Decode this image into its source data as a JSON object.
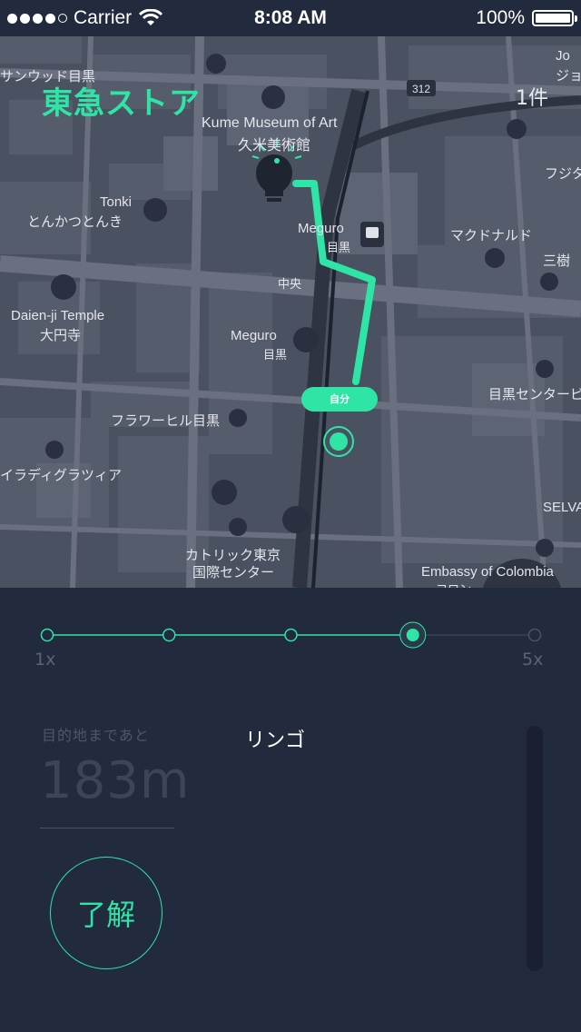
{
  "status_bar": {
    "carrier": "Carrier",
    "time": "8:08 AM",
    "battery": "100%"
  },
  "map": {
    "store_title": "東急ストア",
    "count": "1件",
    "self_label": "自分",
    "labels": {
      "sanwood": "サンウッド目黒",
      "kume_en": "Kume Museum of Art",
      "kume_jp": "久米美術館",
      "tonki_en": "Tonki",
      "tonki_jp": "とんかつとんき",
      "meguro_station": "Meguro",
      "meguro_station_jp": "目黒",
      "mcd": "マクドナルド",
      "mitsuki": "三樹",
      "fuji": "フジタ",
      "jo": "Jo",
      "jo2": "ジョ",
      "daienji_en": "Daien-ji Temple",
      "daienji_jp": "大円寺",
      "chuo": "中央",
      "meguro2": "Meguro",
      "meguro2_jp": "目黒",
      "center": "目黒センタービ",
      "flower": "フラワーヒル目黒",
      "paradise": "イラディグラツィア",
      "catholic": "カトリック東京",
      "catholic2": "国際センター",
      "embassy": "Embassy of Colombia",
      "embassy_jp": "コロン",
      "selva": "SELVA",
      "route": "312"
    }
  },
  "speed_slider": {
    "min_label": "1x",
    "max_label": "5x",
    "steps": 5,
    "selected_step": 4
  },
  "info": {
    "remaining_label": "目的地まであと",
    "distance": "183m",
    "item_name": "リンゴ",
    "ok_label": "了解"
  },
  "colors": {
    "accent": "#2fe5a6",
    "background": "#222a3d",
    "map": "#4a5160"
  }
}
